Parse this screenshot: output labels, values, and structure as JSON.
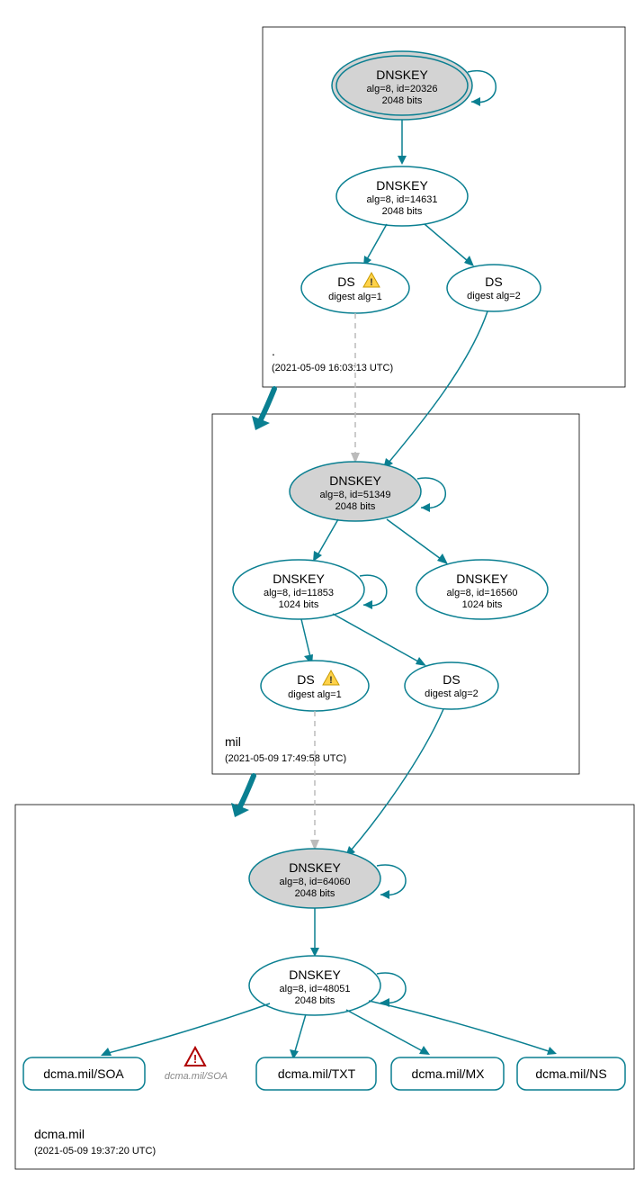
{
  "chart_data": {
    "type": "diagram",
    "description": "DNSSEC authentication chain for dcma.mil",
    "zones": [
      {
        "name": ".",
        "timestamp": "(2021-05-09 16:03:13 UTC)"
      },
      {
        "name": "mil",
        "timestamp": "(2021-05-09 17:49:58 UTC)"
      },
      {
        "name": "dcma.mil",
        "timestamp": "(2021-05-09 19:37:20 UTC)"
      }
    ],
    "nodes": {
      "root_ksk": {
        "title": "DNSKEY",
        "line1": "alg=8, id=20326",
        "line2": "2048 bits",
        "fill": "#d3d3d3",
        "double": true
      },
      "root_zsk": {
        "title": "DNSKEY",
        "line1": "alg=8, id=14631",
        "line2": "2048 bits",
        "fill": "#ffffff"
      },
      "root_ds1": {
        "title": "DS",
        "line1": "digest alg=1",
        "warning": true,
        "fill": "#ffffff"
      },
      "root_ds2": {
        "title": "DS",
        "line1": "digest alg=2",
        "fill": "#ffffff"
      },
      "mil_ksk": {
        "title": "DNSKEY",
        "line1": "alg=8, id=51349",
        "line2": "2048 bits",
        "fill": "#d3d3d3"
      },
      "mil_zsk": {
        "title": "DNSKEY",
        "line1": "alg=8, id=11853",
        "line2": "1024 bits",
        "fill": "#ffffff"
      },
      "mil_zsk2": {
        "title": "DNSKEY",
        "line1": "alg=8, id=16560",
        "line2": "1024 bits",
        "fill": "#ffffff"
      },
      "mil_ds1": {
        "title": "DS",
        "line1": "digest alg=1",
        "warning": true,
        "fill": "#ffffff"
      },
      "mil_ds2": {
        "title": "DS",
        "line1": "digest alg=2",
        "fill": "#ffffff"
      },
      "dcma_ksk": {
        "title": "DNSKEY",
        "line1": "alg=8, id=64060",
        "line2": "2048 bits",
        "fill": "#d3d3d3"
      },
      "dcma_zsk": {
        "title": "DNSKEY",
        "line1": "alg=8, id=48051",
        "line2": "2048 bits",
        "fill": "#ffffff"
      }
    },
    "rrsets": {
      "soa": "dcma.mil/SOA",
      "soa_error": "dcma.mil/SOA",
      "txt": "dcma.mil/TXT",
      "mx": "dcma.mil/MX",
      "ns": "dcma.mil/NS"
    }
  },
  "colors": {
    "teal": "#0a7f91",
    "fill_sep": "#d3d3d3"
  }
}
